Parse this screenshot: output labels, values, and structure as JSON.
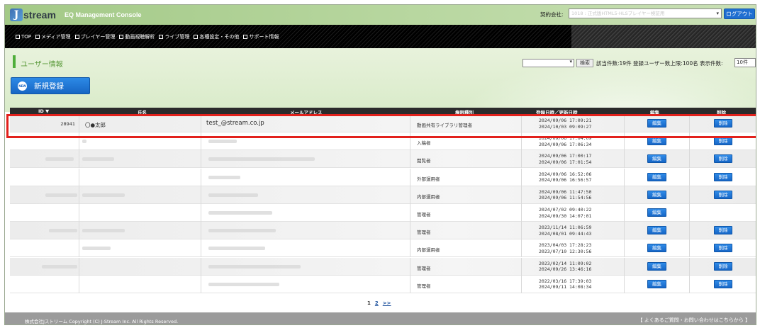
{
  "header": {
    "logo_initial": "J",
    "logo_rest": "stream",
    "console_title": "EQ Management Console",
    "contract_label": "契約会社:",
    "contract_value": "1018 : 正式版HTML5-HLSプレイヤー検証用",
    "logout_label": "ログアウト"
  },
  "nav": {
    "items": [
      "TOP",
      "メディア管理",
      "プレイヤー管理",
      "動画視聴解析",
      "ライブ管理",
      "各種設定・その他",
      "サポート情報"
    ]
  },
  "page": {
    "title": "ユーザー情報",
    "search_button": "検索",
    "counts": "該当件数:19件  登録ユーザー数上限:100名  表示件数:",
    "page_size": "10件",
    "new_button": "新規登録",
    "new_icon_text": "NEW"
  },
  "table": {
    "headers": {
      "id": "ID ▼",
      "name": "氏名",
      "mail": "メールアドレス",
      "role": "権限種別",
      "date": "登録日時／更新日時",
      "edit": "編集",
      "del": "削除"
    },
    "edit_label": "編集",
    "del_label": "削除",
    "rows": [
      {
        "id": "28941",
        "name": "〇●太郎",
        "mail": "test_@stream.co.jp",
        "role": "動画共有ライブラリ管理者",
        "registered": "2024/09/06 17:09:21",
        "updated": "2024/10/03 09:09:27",
        "deletable": true
      },
      {
        "id": "",
        "name": "",
        "mail": "",
        "role": "入稿者",
        "registered": "2024/09/06 17:04:09",
        "updated": "2024/09/06 17:06:34",
        "deletable": true
      },
      {
        "id": "",
        "name": "",
        "mail": "",
        "role": "閲覧者",
        "registered": "2024/09/06 17:00:17",
        "updated": "2024/09/06 17:01:54",
        "deletable": true
      },
      {
        "id": "",
        "name": "",
        "mail": "",
        "role": "外部運用者",
        "registered": "2024/09/06 16:52:06",
        "updated": "2024/09/06 16:56:57",
        "deletable": true
      },
      {
        "id": "",
        "name": "",
        "mail": "",
        "role": "内部運用者",
        "registered": "2024/09/06 11:47:50",
        "updated": "2024/09/06 11:54:56",
        "deletable": true
      },
      {
        "id": "",
        "name": "",
        "mail": "",
        "role": "管理者",
        "registered": "2024/07/02 09:40:22",
        "updated": "2024/09/30 14:07:01",
        "deletable": false
      },
      {
        "id": "",
        "name": "",
        "mail": "",
        "role": "管理者",
        "registered": "2023/11/14 11:06:59",
        "updated": "2024/08/01 09:44:43",
        "deletable": true
      },
      {
        "id": "",
        "name": "",
        "mail": "",
        "role": "内部運用者",
        "registered": "2023/04/03 17:28:23",
        "updated": "2023/07/10 12:30:56",
        "deletable": true
      },
      {
        "id": "",
        "name": "",
        "mail": "",
        "role": "管理者",
        "registered": "2023/02/14 11:09:02",
        "updated": "2024/09/26 13:46:16",
        "deletable": true
      },
      {
        "id": "",
        "name": "",
        "mail": "",
        "role": "管理者",
        "registered": "2022/03/16 17:39:03",
        "updated": "2024/09/11 14:08:34",
        "deletable": true
      }
    ]
  },
  "pager": {
    "current": "1",
    "next_page": "2",
    "next": ">>"
  },
  "footer": {
    "copyright": "株式会社Jストリーム  Copyright (C) J-Stream Inc. All Rights Reserved.",
    "support_link": "【 よくあるご質問・お問い合わせはこちらから 】"
  },
  "colors": {
    "accent_blue": "#1f6fd1",
    "highlight_red": "#e2211c",
    "header_green": "#a3c987"
  }
}
